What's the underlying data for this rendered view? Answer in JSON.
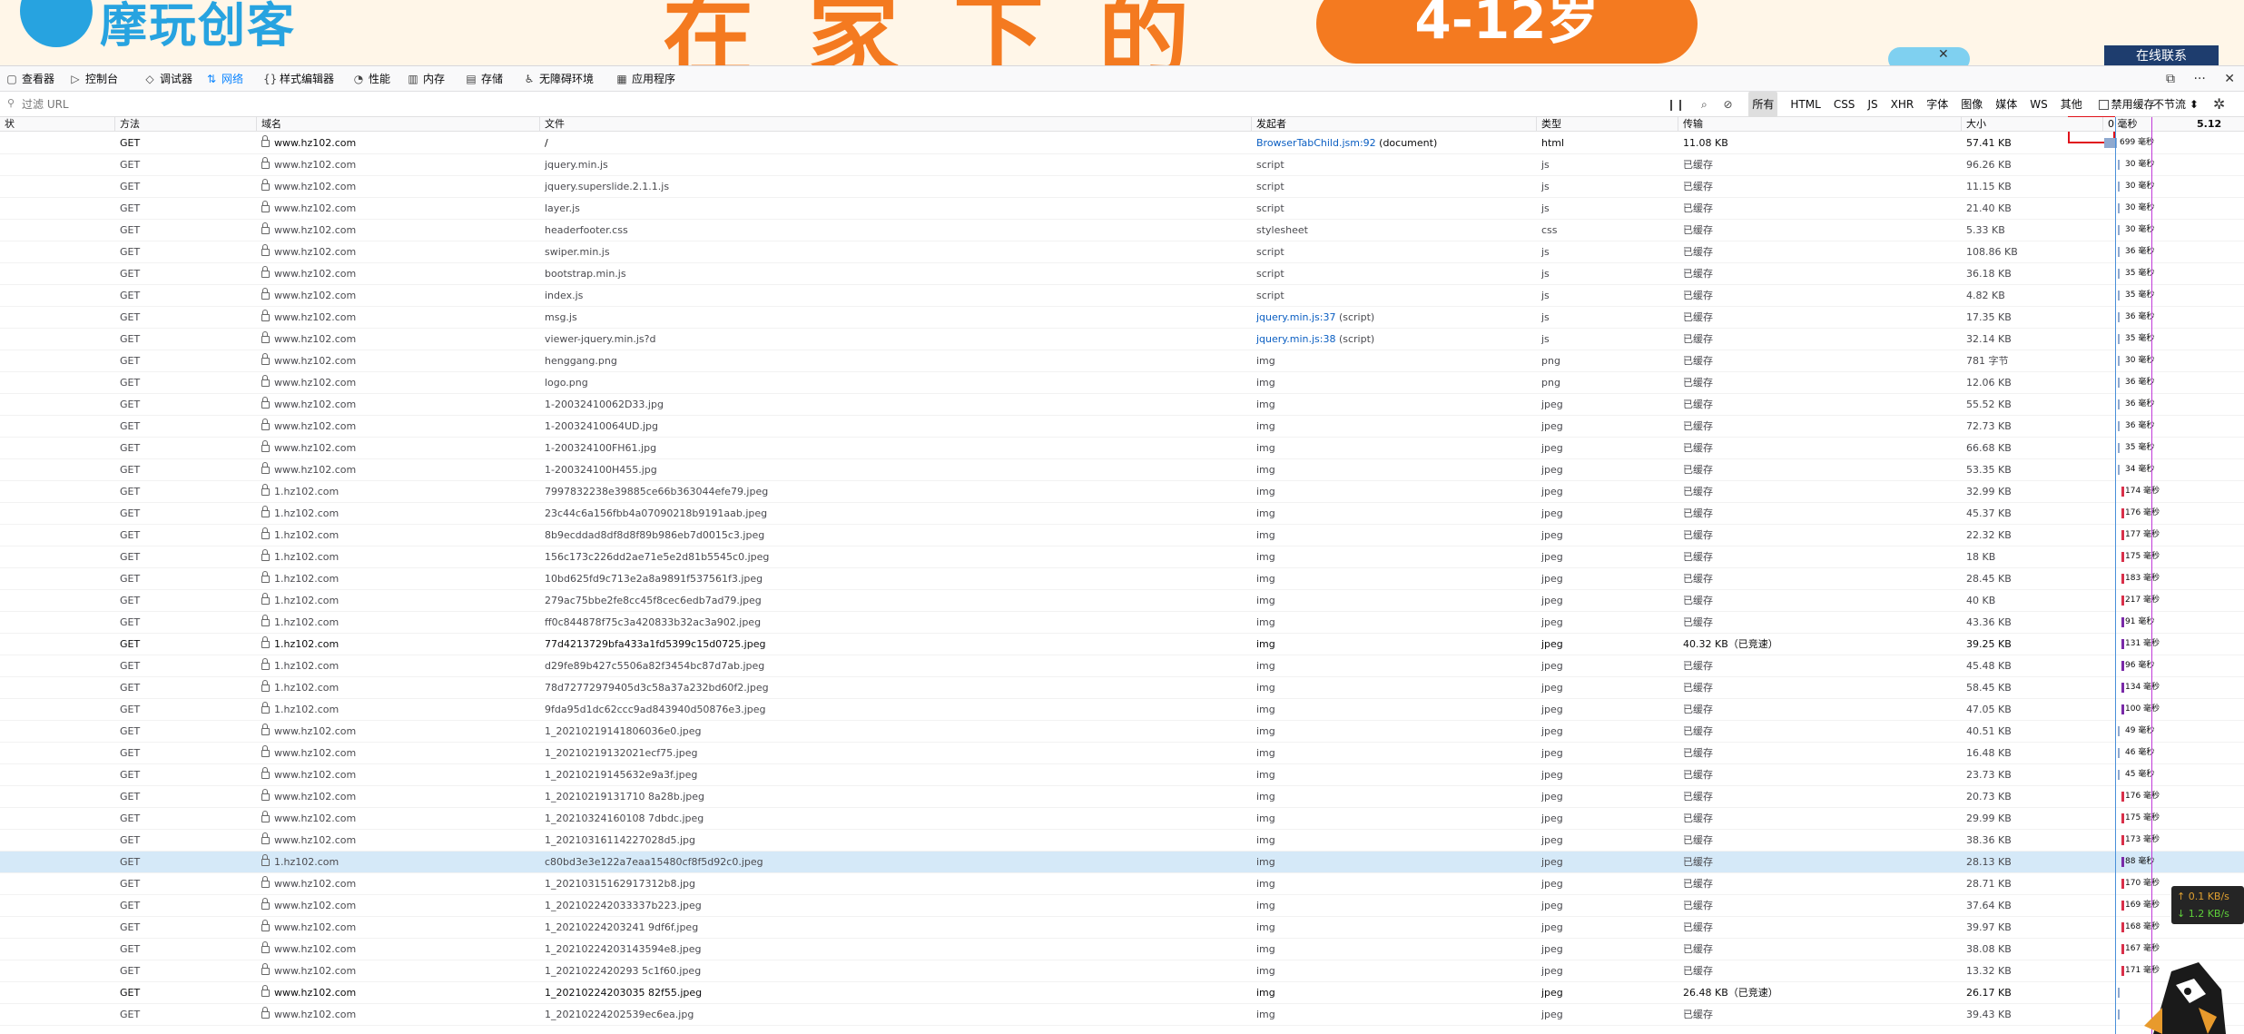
{
  "banner": {
    "logo_text": "摩玩创客",
    "headline": "在家下的",
    "age_range": "4-12岁",
    "online_contact": "在线联系",
    "close_glyph": "✕"
  },
  "devtools": {
    "tabs": [
      {
        "icon": "inspector-icon",
        "glyph": "▢",
        "label": "查看器"
      },
      {
        "icon": "console-icon",
        "glyph": "▷",
        "label": "控制台"
      },
      {
        "icon": "debugger-icon",
        "glyph": "◇",
        "label": "调试器"
      },
      {
        "icon": "network-icon",
        "glyph": "⇅",
        "label": "网络"
      },
      {
        "icon": "style-editor-icon",
        "glyph": "{}",
        "label": "样式编辑器"
      },
      {
        "icon": "performance-icon",
        "glyph": "◔",
        "label": "性能"
      },
      {
        "icon": "memory-icon",
        "glyph": "▥",
        "label": "内存"
      },
      {
        "icon": "storage-icon",
        "glyph": "▤",
        "label": "存储"
      },
      {
        "icon": "accessibility-icon",
        "glyph": "♿",
        "label": "无障碍环境"
      },
      {
        "icon": "application-icon",
        "glyph": "▦",
        "label": "应用程序"
      }
    ],
    "active_tab": "网络",
    "toolbar_right_glyphs": [
      "⧉",
      "···",
      "✕"
    ]
  },
  "filterbar": {
    "placeholder": "过滤 URL",
    "pause_glyph": "❙❙",
    "search_glyph": "⌕",
    "clear_glyph": "⊘",
    "type_filters": [
      "所有",
      "HTML",
      "CSS",
      "JS",
      "XHR",
      "字体",
      "图像",
      "媒体",
      "WS",
      "其他"
    ],
    "active_filter": "所有",
    "disable_cache_label": "禁用缓存",
    "disable_cache_checked": false,
    "throttle_label": "不节流 ⬍",
    "settings_glyph": "✲"
  },
  "table": {
    "headers": {
      "status": "状",
      "method": "方法",
      "domain": "域名",
      "file": "文件",
      "initiator": "发起者",
      "type": "类型",
      "transferred": "传输",
      "size": "大小",
      "timing": "0 毫秒",
      "timing_right": "5.12"
    },
    "rows": [
      {
        "method": "GET",
        "domain": "www.hz102.com",
        "file": "/",
        "initiator": "BrowserTabChild.jsm:92",
        "initiator_suffix": " (document)",
        "type": "html",
        "transferred": "11.08 KB",
        "size": "57.41 KB",
        "time": "699 毫秒",
        "bold": true
      },
      {
        "method": "GET",
        "domain": "www.hz102.com",
        "file": "jquery.min.js",
        "initiator": "script",
        "type": "js",
        "transferred": "已缓存",
        "size": "96.26 KB",
        "time": "30 毫秒"
      },
      {
        "method": "GET",
        "domain": "www.hz102.com",
        "file": "jquery.superslide.2.1.1.js",
        "initiator": "script",
        "type": "js",
        "transferred": "已缓存",
        "size": "11.15 KB",
        "time": "30 毫秒"
      },
      {
        "method": "GET",
        "domain": "www.hz102.com",
        "file": "layer.js",
        "initiator": "script",
        "type": "js",
        "transferred": "已缓存",
        "size": "21.40 KB",
        "time": "30 毫秒"
      },
      {
        "method": "GET",
        "domain": "www.hz102.com",
        "file": "headerfooter.css",
        "initiator": "stylesheet",
        "type": "css",
        "transferred": "已缓存",
        "size": "5.33 KB",
        "time": "30 毫秒"
      },
      {
        "method": "GET",
        "domain": "www.hz102.com",
        "file": "swiper.min.js",
        "initiator": "script",
        "type": "js",
        "transferred": "已缓存",
        "size": "108.86 KB",
        "time": "36 毫秒"
      },
      {
        "method": "GET",
        "domain": "www.hz102.com",
        "file": "bootstrap.min.js",
        "initiator": "script",
        "type": "js",
        "transferred": "已缓存",
        "size": "36.18 KB",
        "time": "35 毫秒"
      },
      {
        "method": "GET",
        "domain": "www.hz102.com",
        "file": "index.js",
        "initiator": "script",
        "type": "js",
        "transferred": "已缓存",
        "size": "4.82 KB",
        "time": "35 毫秒"
      },
      {
        "method": "GET",
        "domain": "www.hz102.com",
        "file": "msg.js",
        "initiator": "jquery.min.js:37",
        "initiator_suffix": " (script)",
        "type": "js",
        "transferred": "已缓存",
        "size": "17.35 KB",
        "time": "36 毫秒"
      },
      {
        "method": "GET",
        "domain": "www.hz102.com",
        "file": "viewer-jquery.min.js?d",
        "initiator": "jquery.min.js:38",
        "initiator_suffix": " (script)",
        "type": "js",
        "transferred": "已缓存",
        "size": "32.14 KB",
        "time": "35 毫秒"
      },
      {
        "method": "GET",
        "domain": "www.hz102.com",
        "file": "henggang.png",
        "initiator": "img",
        "type": "png",
        "transferred": "已缓存",
        "size": "781 字节",
        "time": "30 毫秒"
      },
      {
        "method": "GET",
        "domain": "www.hz102.com",
        "file": "logo.png",
        "initiator": "img",
        "type": "png",
        "transferred": "已缓存",
        "size": "12.06 KB",
        "time": "36 毫秒"
      },
      {
        "method": "GET",
        "domain": "www.hz102.com",
        "file": "1-20032410062D33.jpg",
        "initiator": "img",
        "type": "jpeg",
        "transferred": "已缓存",
        "size": "55.52 KB",
        "time": "36 毫秒"
      },
      {
        "method": "GET",
        "domain": "www.hz102.com",
        "file": "1-20032410064UD.jpg",
        "initiator": "img",
        "type": "jpeg",
        "transferred": "已缓存",
        "size": "72.73 KB",
        "time": "36 毫秒"
      },
      {
        "method": "GET",
        "domain": "www.hz102.com",
        "file": "1-200324100FH61.jpg",
        "initiator": "img",
        "type": "jpeg",
        "transferred": "已缓存",
        "size": "66.68 KB",
        "time": "35 毫秒"
      },
      {
        "method": "GET",
        "domain": "www.hz102.com",
        "file": "1-200324100H455.jpg",
        "initiator": "img",
        "type": "jpeg",
        "transferred": "已缓存",
        "size": "53.35 KB",
        "time": "34 毫秒"
      },
      {
        "method": "GET",
        "domain": "1.hz102.com",
        "file": "7997832238e39885ce66b363044efe79.jpeg",
        "initiator": "img",
        "type": "jpeg",
        "transferred": "已缓存",
        "size": "32.99 KB",
        "time": "174 毫秒"
      },
      {
        "method": "GET",
        "domain": "1.hz102.com",
        "file": "23c44c6a156fbb4a07090218b9191aab.jpeg",
        "initiator": "img",
        "type": "jpeg",
        "transferred": "已缓存",
        "size": "45.37 KB",
        "time": "176 毫秒"
      },
      {
        "method": "GET",
        "domain": "1.hz102.com",
        "file": "8b9ecddad8df8d8f89b986eb7d0015c3.jpeg",
        "initiator": "img",
        "type": "jpeg",
        "transferred": "已缓存",
        "size": "22.32 KB",
        "time": "177 毫秒"
      },
      {
        "method": "GET",
        "domain": "1.hz102.com",
        "file": "156c173c226dd2ae71e5e2d81b5545c0.jpeg",
        "initiator": "img",
        "type": "jpeg",
        "transferred": "已缓存",
        "size": "18 KB",
        "time": "175 毫秒"
      },
      {
        "method": "GET",
        "domain": "1.hz102.com",
        "file": "10bd625fd9c713e2a8a9891f537561f3.jpeg",
        "initiator": "img",
        "type": "jpeg",
        "transferred": "已缓存",
        "size": "28.45 KB",
        "time": "183 毫秒"
      },
      {
        "method": "GET",
        "domain": "1.hz102.com",
        "file": "279ac75bbe2fe8cc45f8cec6edb7ad79.jpeg",
        "initiator": "img",
        "type": "jpeg",
        "transferred": "已缓存",
        "size": "40 KB",
        "time": "217 毫秒"
      },
      {
        "method": "GET",
        "domain": "1.hz102.com",
        "file": "ff0c844878f75c3a420833b32ac3a902.jpeg",
        "initiator": "img",
        "type": "jpeg",
        "transferred": "已缓存",
        "size": "43.36 KB",
        "time": "91 毫秒"
      },
      {
        "method": "GET",
        "domain": "1.hz102.com",
        "file": "77d4213729bfa433a1fd5399c15d0725.jpeg",
        "initiator": "img",
        "type": "jpeg",
        "transferred": "40.32 KB（已竞速）",
        "size": "39.25 KB",
        "time": "131 毫秒",
        "bold": true
      },
      {
        "method": "GET",
        "domain": "1.hz102.com",
        "file": "d29fe89b427c5506a82f3454bc87d7ab.jpeg",
        "initiator": "img",
        "type": "jpeg",
        "transferred": "已缓存",
        "size": "45.48 KB",
        "time": "96 毫秒"
      },
      {
        "method": "GET",
        "domain": "1.hz102.com",
        "file": "78d72772979405d3c58a37a232bd60f2.jpeg",
        "initiator": "img",
        "type": "jpeg",
        "transferred": "已缓存",
        "size": "58.45 KB",
        "time": "134 毫秒"
      },
      {
        "method": "GET",
        "domain": "1.hz102.com",
        "file": "9fda95d1dc62ccc9ad843940d50876e3.jpeg",
        "initiator": "img",
        "type": "jpeg",
        "transferred": "已缓存",
        "size": "47.05 KB",
        "time": "100 毫秒"
      },
      {
        "method": "GET",
        "domain": "www.hz102.com",
        "file": "1_20210219141806036e0.jpeg",
        "initiator": "img",
        "type": "jpeg",
        "transferred": "已缓存",
        "size": "40.51 KB",
        "time": "49 毫秒"
      },
      {
        "method": "GET",
        "domain": "www.hz102.com",
        "file": "1_20210219132021ecf75.jpeg",
        "initiator": "img",
        "type": "jpeg",
        "transferred": "已缓存",
        "size": "16.48 KB",
        "time": "46 毫秒"
      },
      {
        "method": "GET",
        "domain": "www.hz102.com",
        "file": "1_20210219145632e9a3f.jpeg",
        "initiator": "img",
        "type": "jpeg",
        "transferred": "已缓存",
        "size": "23.73 KB",
        "time": "45 毫秒"
      },
      {
        "method": "GET",
        "domain": "www.hz102.com",
        "file": "1_20210219131710 8a28b.jpeg",
        "initiator": "img",
        "type": "jpeg",
        "transferred": "已缓存",
        "size": "20.73 KB",
        "time": "176 毫秒"
      },
      {
        "method": "GET",
        "domain": "www.hz102.com",
        "file": "1_20210324160108 7dbdc.jpeg",
        "initiator": "img",
        "type": "jpeg",
        "transferred": "已缓存",
        "size": "29.99 KB",
        "time": "175 毫秒"
      },
      {
        "method": "GET",
        "domain": "www.hz102.com",
        "file": "1_20210316114227028d5.jpg",
        "initiator": "img",
        "type": "jpeg",
        "transferred": "已缓存",
        "size": "38.36 KB",
        "time": "173 毫秒"
      },
      {
        "method": "GET",
        "domain": "1.hz102.com",
        "file": "c80bd3e3e122a7eaa15480cf8f5d92c0.jpeg",
        "initiator": "img",
        "type": "jpeg",
        "transferred": "已缓存",
        "size": "28.13 KB",
        "time": "88 毫秒",
        "selected": true
      },
      {
        "method": "GET",
        "domain": "www.hz102.com",
        "file": "1_20210315162917312b8.jpg",
        "initiator": "img",
        "type": "jpeg",
        "transferred": "已缓存",
        "size": "28.71 KB",
        "time": "170 毫秒"
      },
      {
        "method": "GET",
        "domain": "www.hz102.com",
        "file": "1_202102242033337b223.jpeg",
        "initiator": "img",
        "type": "jpeg",
        "transferred": "已缓存",
        "size": "37.64 KB",
        "time": "169 毫秒"
      },
      {
        "method": "GET",
        "domain": "www.hz102.com",
        "file": "1_20210224203241 9df6f.jpeg",
        "initiator": "img",
        "type": "jpeg",
        "transferred": "已缓存",
        "size": "39.97 KB",
        "time": "168 毫秒"
      },
      {
        "method": "GET",
        "domain": "www.hz102.com",
        "file": "1_20210224203143594e8.jpeg",
        "initiator": "img",
        "type": "jpeg",
        "transferred": "已缓存",
        "size": "38.08 KB",
        "time": "167 毫秒"
      },
      {
        "method": "GET",
        "domain": "www.hz102.com",
        "file": "1_2021022420293 5c1f60.jpeg",
        "initiator": "img",
        "type": "jpeg",
        "transferred": "已缓存",
        "size": "13.32 KB",
        "time": "171 毫秒"
      },
      {
        "method": "GET",
        "domain": "www.hz102.com",
        "file": "1_20210224203035 82f55.jpeg",
        "initiator": "img",
        "type": "jpeg",
        "transferred": "26.48 KB（已竞速）",
        "size": "26.17 KB",
        "time": "",
        "bold": true
      },
      {
        "method": "GET",
        "domain": "www.hz102.com",
        "file": "1_20210224202539ec6ea.jpg",
        "initiator": "img",
        "type": "jpeg",
        "transferred": "已缓存",
        "size": "39.43 KB",
        "time": ""
      }
    ]
  },
  "speed": {
    "up": "↑ 0.1 KB/s",
    "down": "↓ 1.2 KB/s"
  },
  "colors": {
    "accent": "#0a84ff",
    "highlight_box": "#e0121b",
    "selected_row": "#d5e9f8"
  }
}
